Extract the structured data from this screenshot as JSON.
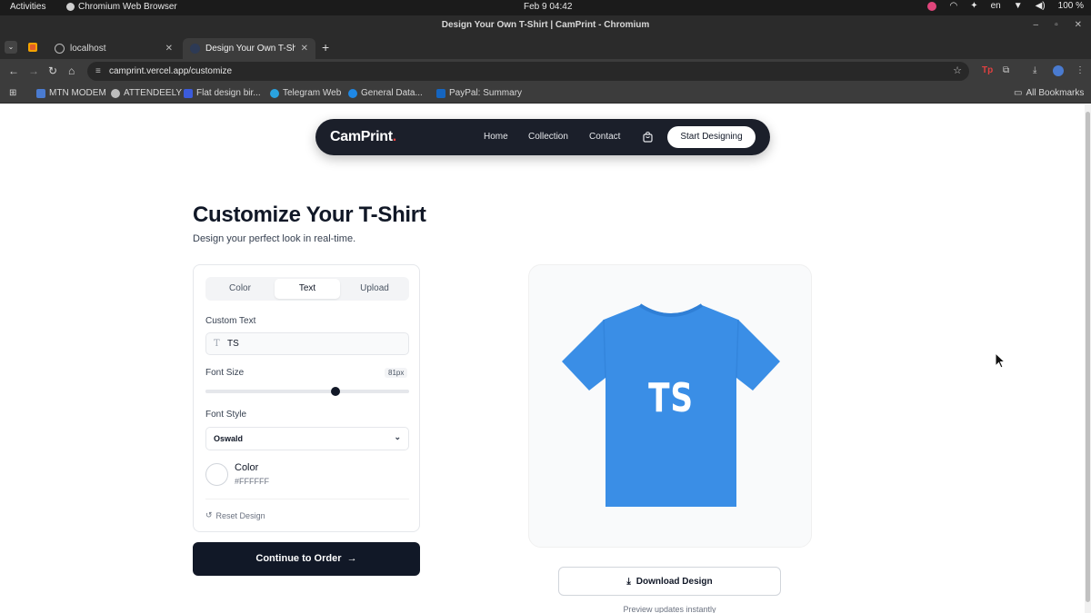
{
  "system_bar": {
    "activities": "Activities",
    "app_name": "Chromium Web Browser",
    "clock": "Feb 9  04:42",
    "lang": "en",
    "battery": "100 %"
  },
  "browser": {
    "window_title": "Design Your Own T-Shirt | CamPrint - Chromium",
    "tabs": [
      {
        "label": "localhost"
      },
      {
        "label": "Design Your Own T-Shirt"
      }
    ],
    "url": "camprint.vercel.app/customize",
    "bookmarks": [
      {
        "label": "MTN MODEM",
        "color": "#4a7bd0"
      },
      {
        "label": "ATTENDEELY",
        "color": "#bdbdbd"
      },
      {
        "label": "Flat design bir...",
        "color": "#3b5bdb"
      },
      {
        "label": "Telegram Web",
        "color": "#2aa3e0"
      },
      {
        "label": "General Data...",
        "color": "#1e88e5"
      },
      {
        "label": "PayPal: Summary",
        "color": "#1565c0"
      }
    ],
    "all_bookmarks": "All Bookmarks",
    "window_controls": [
      "–",
      "▫",
      "✕"
    ]
  },
  "site": {
    "logo": "CamPrint",
    "logo_dot": ".",
    "nav": [
      "Home",
      "Collection",
      "Contact"
    ],
    "start_button": "Start Designing"
  },
  "header": {
    "title": "Customize Your T-Shirt",
    "subtitle": "Design your perfect look in real-time."
  },
  "editor": {
    "tabs": [
      "Color",
      "Text",
      "Upload"
    ],
    "active_tab": "Text",
    "custom_text_label": "Custom Text",
    "custom_text_value": "TS",
    "font_size_label": "Font Size",
    "font_size_value": "81px",
    "font_size_fraction": 0.64,
    "font_style_label": "Font Style",
    "font_style_value": "Oswald",
    "color_label": "Color",
    "color_hex": "#FFFFFF",
    "reset_label": "Reset Design"
  },
  "actions": {
    "order_button": "Continue to Order",
    "download_button": "Download Design",
    "preview_note": "Preview updates instantly"
  },
  "preview": {
    "shirt_color": "#3a8ee6",
    "shirt_text": "TS",
    "text_color": "#FFFFFF"
  },
  "colors": {
    "nav_bg": "#1b1f2a",
    "primary": "#111827",
    "accent": "#ef4444"
  }
}
